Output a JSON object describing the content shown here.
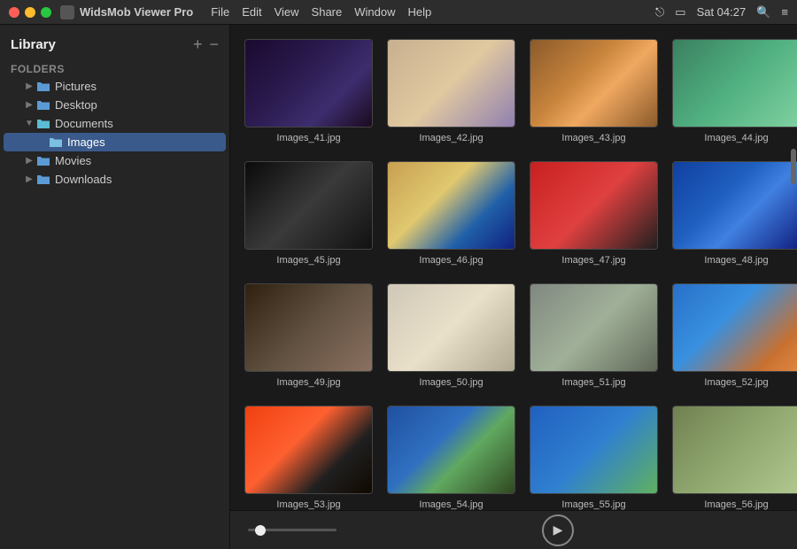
{
  "titlebar": {
    "app_name": "WidsMob Viewer Pro",
    "menus": [
      "File",
      "Edit",
      "View",
      "Share",
      "Window",
      "Help"
    ],
    "time": "Sat 04:27"
  },
  "sidebar": {
    "title": "Library",
    "add_label": "+",
    "remove_label": "−",
    "sections": [
      {
        "label": "Folders",
        "items": [
          {
            "id": "pictures",
            "name": "Pictures",
            "indent": 1,
            "expanded": false,
            "selected": false
          },
          {
            "id": "desktop",
            "name": "Desktop",
            "indent": 1,
            "expanded": false,
            "selected": false
          },
          {
            "id": "documents",
            "name": "Documents",
            "indent": 1,
            "expanded": true,
            "selected": false
          },
          {
            "id": "images",
            "name": "Images",
            "indent": 2,
            "expanded": false,
            "selected": true
          },
          {
            "id": "movies",
            "name": "Movies",
            "indent": 1,
            "expanded": false,
            "selected": false
          },
          {
            "id": "downloads",
            "name": "Downloads",
            "indent": 1,
            "expanded": false,
            "selected": false
          }
        ]
      }
    ]
  },
  "images": [
    {
      "id": "41",
      "label": "Images_41.jpg",
      "class": "img-41"
    },
    {
      "id": "42",
      "label": "Images_42.jpg",
      "class": "img-42"
    },
    {
      "id": "43",
      "label": "Images_43.jpg",
      "class": "img-43"
    },
    {
      "id": "44",
      "label": "Images_44.jpg",
      "class": "img-44"
    },
    {
      "id": "45",
      "label": "Images_45.jpg",
      "class": "img-45"
    },
    {
      "id": "46",
      "label": "Images_46.jpg",
      "class": "img-46"
    },
    {
      "id": "47",
      "label": "Images_47.jpg",
      "class": "img-47"
    },
    {
      "id": "48",
      "label": "Images_48.jpg",
      "class": "img-48"
    },
    {
      "id": "49",
      "label": "Images_49.jpg",
      "class": "img-49"
    },
    {
      "id": "50",
      "label": "Images_50.jpg",
      "class": "img-50"
    },
    {
      "id": "51",
      "label": "Images_51.jpg",
      "class": "img-51"
    },
    {
      "id": "52",
      "label": "Images_52.jpg",
      "class": "img-52"
    },
    {
      "id": "53",
      "label": "Images_53.jpg",
      "class": "img-53"
    },
    {
      "id": "54",
      "label": "Images_54.jpg",
      "class": "img-54"
    },
    {
      "id": "55",
      "label": "Images_55.jpg",
      "class": "img-55"
    },
    {
      "id": "56",
      "label": "Images_56.jpg",
      "class": "img-56"
    }
  ],
  "bottombar": {
    "play_icon": "▶"
  }
}
